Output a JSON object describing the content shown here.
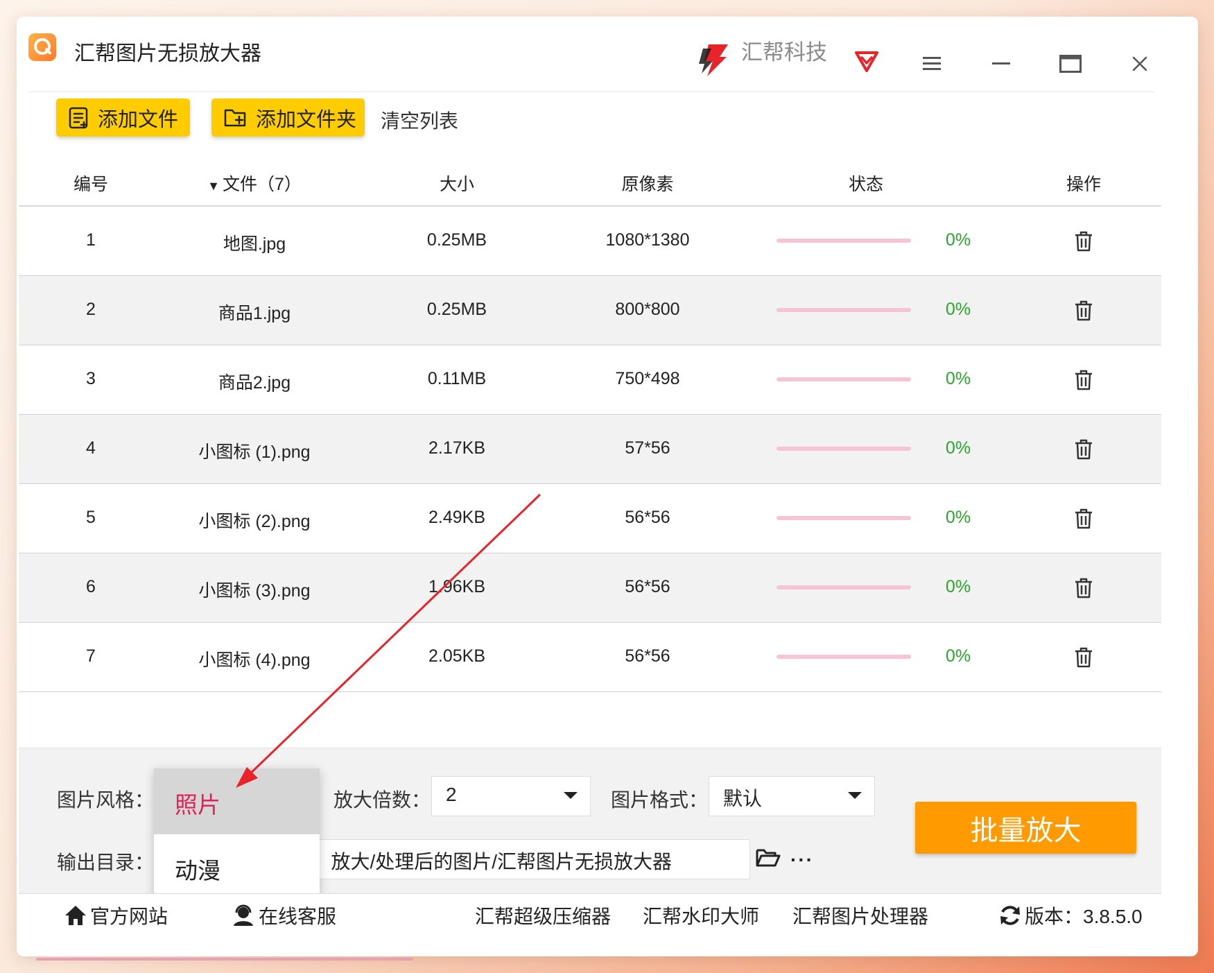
{
  "app": {
    "title": "汇帮图片无损放大器",
    "brand": "汇帮科技"
  },
  "titlebar_icons": [
    "menu-icon",
    "minimize-icon",
    "maximize-icon",
    "close-icon"
  ],
  "toolbar": {
    "add_file": "添加文件",
    "add_folder": "添加文件夹",
    "clear_list": "清空列表"
  },
  "table": {
    "headers": {
      "index": "编号",
      "file": "文件（7）",
      "size": "大小",
      "pixels": "原像素",
      "status": "状态",
      "action": "操作"
    },
    "rows": [
      {
        "index": "1",
        "name": "地图.jpg",
        "size": "0.25MB",
        "pixels": "1080*1380",
        "progress": 0,
        "progress_text": "0%"
      },
      {
        "index": "2",
        "name": "商品1.jpg",
        "size": "0.25MB",
        "pixels": "800*800",
        "progress": 0,
        "progress_text": "0%"
      },
      {
        "index": "3",
        "name": "商品2.jpg",
        "size": "0.11MB",
        "pixels": "750*498",
        "progress": 0,
        "progress_text": "0%"
      },
      {
        "index": "4",
        "name": "小图标 (1).png",
        "size": "2.17KB",
        "pixels": "57*56",
        "progress": 0,
        "progress_text": "0%"
      },
      {
        "index": "5",
        "name": "小图标 (2).png",
        "size": "2.49KB",
        "pixels": "56*56",
        "progress": 0,
        "progress_text": "0%"
      },
      {
        "index": "6",
        "name": "小图标 (3).png",
        "size": "1.96KB",
        "pixels": "56*56",
        "progress": 0,
        "progress_text": "0%"
      },
      {
        "index": "7",
        "name": "小图标 (4).png",
        "size": "2.05KB",
        "pixels": "56*56",
        "progress": 0,
        "progress_text": "0%"
      }
    ]
  },
  "settings": {
    "style_label": "图片风格：",
    "style_options": [
      "照片",
      "动漫"
    ],
    "style_selected": "照片",
    "scale_label": "放大倍数：",
    "scale_value": "2",
    "format_label": "图片格式：",
    "format_value": "默认",
    "output_label": "输出目录：",
    "output_path": "放大/处理后的图片/汇帮图片无损放大器",
    "more": "···",
    "batch_button": "批量放大"
  },
  "footer": {
    "website": "官方网站",
    "support": "在线客服",
    "compressor": "汇帮超级压缩器",
    "watermark": "汇帮水印大师",
    "processor": "汇帮图片处理器",
    "version": "版本：3.8.5.0"
  },
  "colors": {
    "accent_yellow": "#ffcc00",
    "batch_orange": "#ff9a00",
    "progress_pink": "#f5c5d6",
    "percent_green": "#2aa52a",
    "selected_red": "#e0205a"
  }
}
